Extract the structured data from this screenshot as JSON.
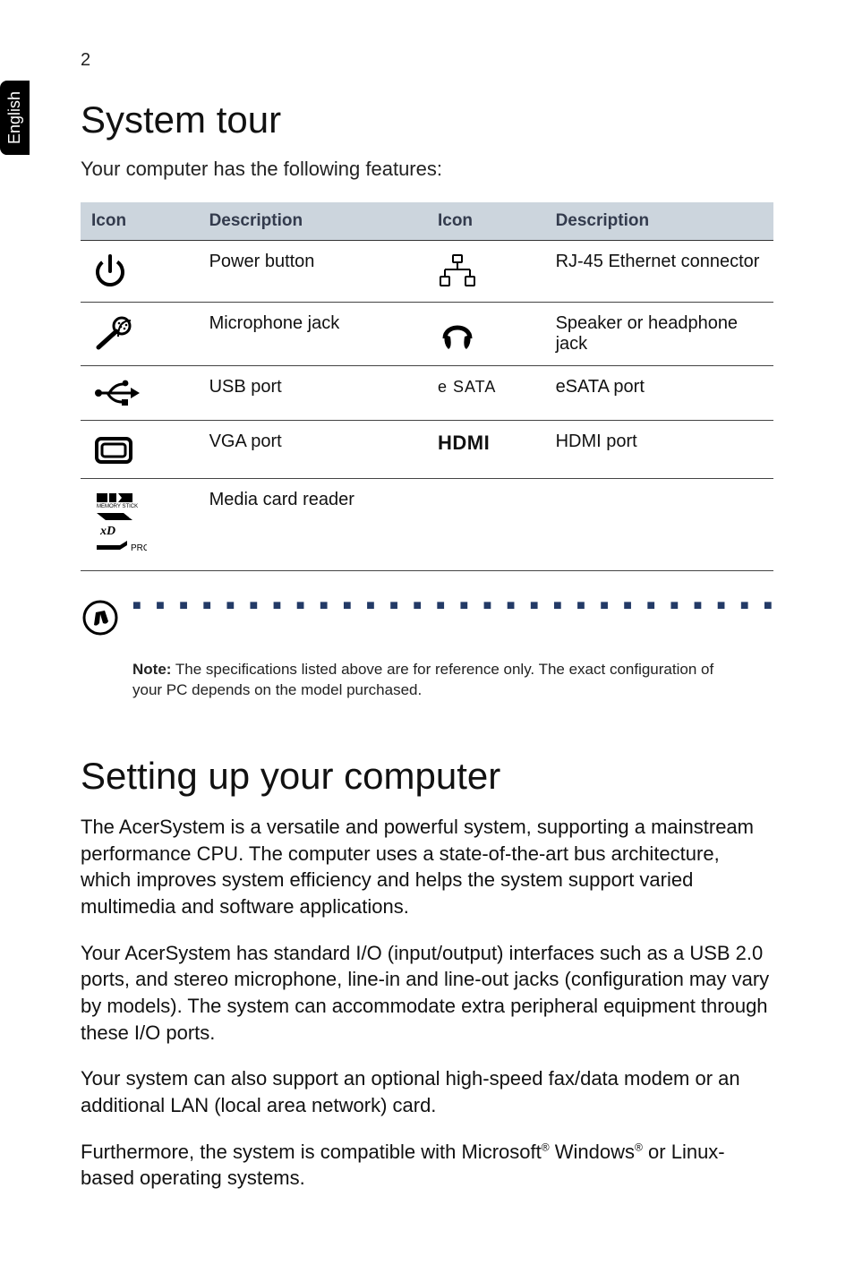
{
  "page_number": "2",
  "lang_tab": "English",
  "heading1": "System tour",
  "intro": "Your computer has the following features:",
  "table": {
    "headers": {
      "icon1": "Icon",
      "desc1": "Description",
      "icon2": "Icon",
      "desc2": "Description"
    },
    "rows": [
      {
        "leftDesc": "Power button",
        "rightLabel": "",
        "rightDesc": "RJ-45 Ethernet connector"
      },
      {
        "leftDesc": "Microphone jack",
        "rightLabel": "",
        "rightDesc": "Speaker or headphone jack"
      },
      {
        "leftDesc": "USB port",
        "rightLabel": "e SATA",
        "rightDesc": "eSATA port"
      },
      {
        "leftDesc": "VGA port",
        "rightLabel": "HDMI",
        "rightDesc": "HDMI port"
      },
      {
        "leftDesc": "Media card reader",
        "rightLabel": "",
        "rightDesc": ""
      }
    ],
    "mediaRowLabels": {
      "line1": "PRO"
    }
  },
  "note": {
    "label": "Note:",
    "text": " The specifications listed above are for reference only. The exact configuration of your PC depends on the model purchased."
  },
  "heading2": "Setting up your computer",
  "p1": "The AcerSystem is a versatile and powerful system, supporting a mainstream performance CPU. The computer uses a state-of-the-art bus architecture, which improves system efficiency and helps the system support varied multimedia and software applications.",
  "p2": "Your AcerSystem has standard I/O (input/output) interfaces such as a USB 2.0 ports, and stereo microphone, line-in and line-out jacks (configuration may vary by models). The system can accommodate extra peripheral equipment through these I/O ports.",
  "p3": "Your system can also support an optional high-speed fax/data modem or an additional LAN (local area network) card.",
  "p4_1": "Furthermore, the system is compatible with Microsoft",
  "p4_2": " Windows",
  "p4_3": " or Linux-based operating systems.",
  "reg": "®"
}
